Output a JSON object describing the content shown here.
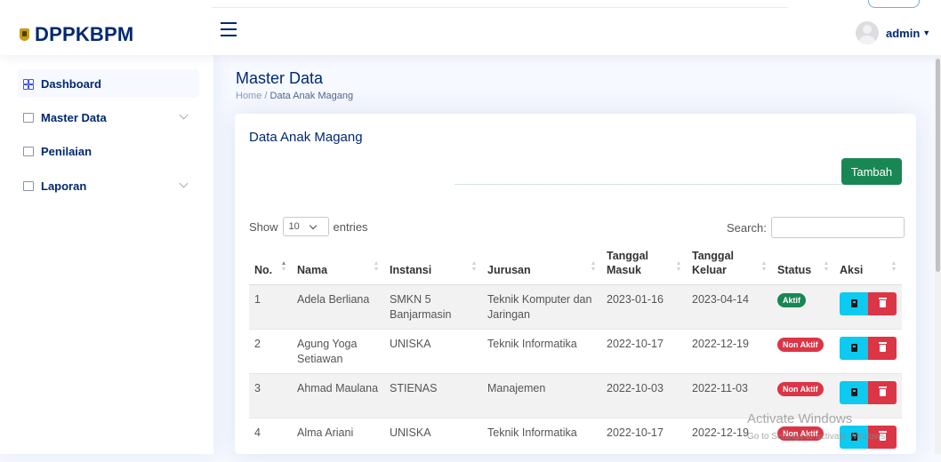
{
  "header": {
    "brand": "DPPKBPM",
    "user": "admin"
  },
  "sidebar": {
    "items": [
      {
        "label": "Dashboard"
      },
      {
        "label": "Master Data"
      },
      {
        "label": "Penilaian"
      },
      {
        "label": "Laporan"
      }
    ]
  },
  "page": {
    "title": "Master Data",
    "breadcrumb_home": "Home",
    "breadcrumb_sep": "/",
    "breadcrumb_current": "Data Anak Magang"
  },
  "card": {
    "title": "Data Anak Magang",
    "add_button": "Tambah",
    "show_label": "Show",
    "entries_value": "10",
    "entries_label": "entries",
    "search_label": "Search:"
  },
  "table": {
    "headers": {
      "no": "No.",
      "nama": "Nama",
      "instansi": "Instansi",
      "jurusan": "Jurusan",
      "masuk": "Tanggal Masuk",
      "keluar": "Tanggal Keluar",
      "status": "Status",
      "aksi": "Aksi"
    },
    "rows": [
      {
        "no": "1",
        "nama": "Adela Berliana",
        "instansi": "SMKN 5 Banjarmasin",
        "jurusan": "Teknik Komputer dan Jaringan",
        "masuk": "2023-01-16",
        "keluar": "2023-04-14",
        "status": "Aktif"
      },
      {
        "no": "2",
        "nama": "Agung Yoga Setiawan",
        "instansi": "UNISKA",
        "jurusan": "Teknik Informatika",
        "masuk": "2022-10-17",
        "keluar": "2022-12-19",
        "status": "Non Aktif"
      },
      {
        "no": "3",
        "nama": "Ahmad Maulana",
        "instansi": "STIENAS",
        "jurusan": "Manajemen",
        "masuk": "2022-10-03",
        "keluar": "2022-11-03",
        "status": "Non Aktif"
      },
      {
        "no": "4",
        "nama": "Alma Ariani",
        "instansi": "UNISKA",
        "jurusan": "Teknik Informatika",
        "masuk": "2022-10-17",
        "keluar": "2022-12-19",
        "status": "Non Aktif"
      }
    ]
  },
  "watermark": {
    "line1": "Activate Windows",
    "line2": "Go to Settings to activate Windows."
  },
  "colors": {
    "brand": "#012970",
    "success": "#198754",
    "danger": "#dc3545",
    "info": "#0dcaf0"
  }
}
